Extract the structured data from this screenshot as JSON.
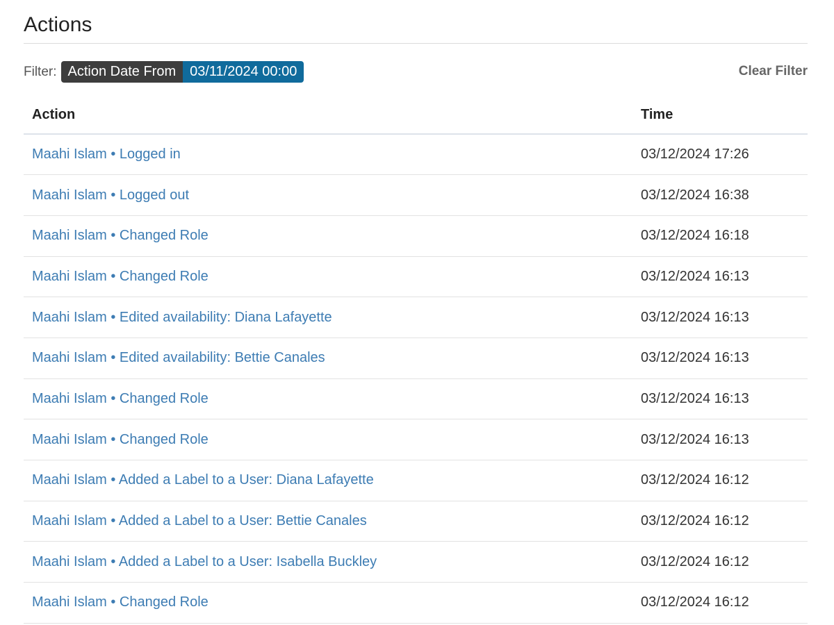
{
  "page": {
    "title": "Actions"
  },
  "filter": {
    "label": "Filter:",
    "chip_key": "Action Date From",
    "chip_value": "03/11/2024 00:00",
    "clear_label": "Clear Filter"
  },
  "table": {
    "columns": {
      "action": "Action",
      "time": "Time"
    },
    "rows": [
      {
        "action": "Maahi Islam • Logged in",
        "time": "03/12/2024 17:26"
      },
      {
        "action": "Maahi Islam • Logged out",
        "time": "03/12/2024 16:38"
      },
      {
        "action": "Maahi Islam • Changed Role",
        "time": "03/12/2024 16:18"
      },
      {
        "action": "Maahi Islam • Changed Role",
        "time": "03/12/2024 16:13"
      },
      {
        "action": "Maahi Islam • Edited availability: Diana Lafayette",
        "time": "03/12/2024 16:13"
      },
      {
        "action": "Maahi Islam • Edited availability: Bettie Canales",
        "time": "03/12/2024 16:13"
      },
      {
        "action": "Maahi Islam • Changed Role",
        "time": "03/12/2024 16:13"
      },
      {
        "action": "Maahi Islam • Changed Role",
        "time": "03/12/2024 16:13"
      },
      {
        "action": "Maahi Islam • Added a Label to a User: Diana Lafayette",
        "time": "03/12/2024 16:12"
      },
      {
        "action": "Maahi Islam • Added a Label to a User: Bettie Canales",
        "time": "03/12/2024 16:12"
      },
      {
        "action": "Maahi Islam • Added a Label to a User: Isabella Buckley",
        "time": "03/12/2024 16:12"
      },
      {
        "action": "Maahi Islam • Changed Role",
        "time": "03/12/2024 16:12"
      }
    ]
  },
  "colors": {
    "link": "#3d7cb3",
    "chip_key_bg": "#3d3d3d",
    "chip_value_bg": "#106b9c"
  }
}
